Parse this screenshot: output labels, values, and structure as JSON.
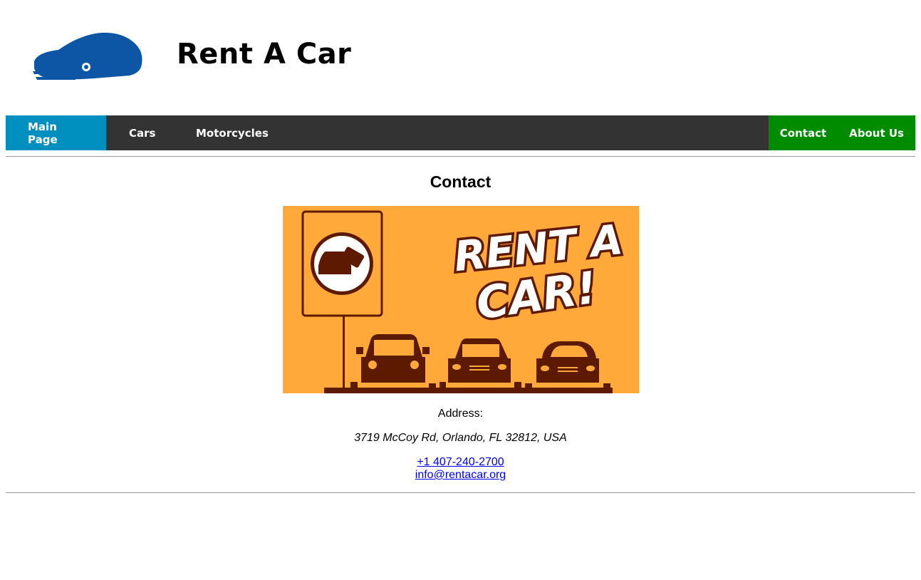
{
  "header": {
    "logo_icon": "car-logo-icon",
    "title": "Rent A Car",
    "logo_color": "#0d56a6"
  },
  "nav": {
    "left": [
      "Main Page",
      "Cars",
      "Motorcycles"
    ],
    "right": [
      "Contact",
      "About Us"
    ],
    "active": "Main Page",
    "colors": {
      "bar": "#333333",
      "active": "#0090c0",
      "right_group": "#008c00",
      "text": "#ffffff"
    }
  },
  "contact": {
    "heading": "Contact",
    "banner": {
      "icon": "rent-a-car-banner",
      "text_line1": "RENT A",
      "text_line2": "CAR!",
      "background": "#ffa93a",
      "ink": "#5e1a00"
    },
    "address_label": "Address:",
    "address": "3719 McCoy Rd, Orlando, FL 32812, USA",
    "phone": "+1 407-240-2700",
    "email": "info@rentacar.org",
    "link_color": "#0000ee"
  }
}
